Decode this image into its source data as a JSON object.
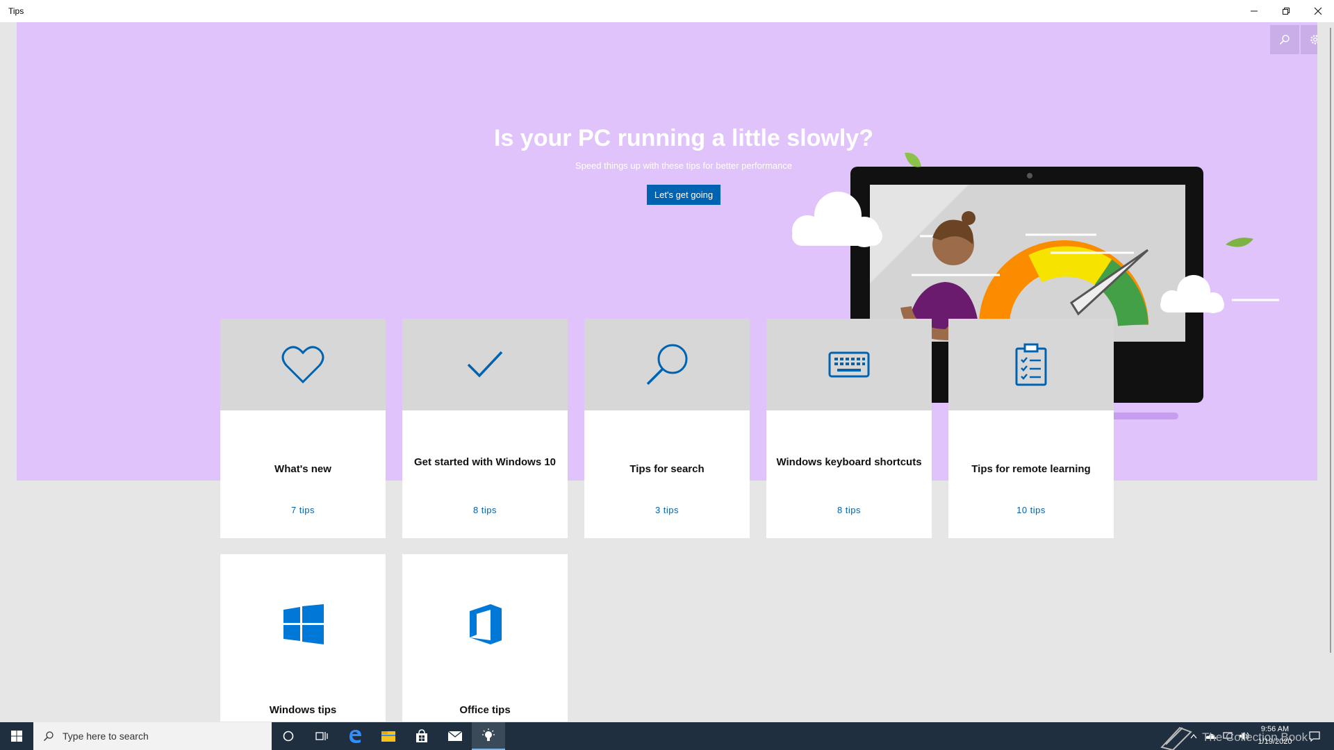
{
  "window": {
    "title": "Tips",
    "minimize_icon": "minimize-icon",
    "restore_icon": "restore-icon",
    "close_icon": "close-icon"
  },
  "hero": {
    "title": "Is your PC running a little slowly?",
    "subtitle": "Speed things up with these tips for better performance",
    "cta_label": "Let's get going",
    "background_color": "#e0c3fb"
  },
  "toolbar": {
    "search_icon": "search-icon",
    "settings_icon": "gear-icon"
  },
  "cards": [
    {
      "title": "What's new",
      "count": "7 tips",
      "icon": "heart-icon"
    },
    {
      "title": "Get started with Windows 10",
      "count": "8 tips",
      "icon": "checkmark-icon"
    },
    {
      "title": "Tips for search",
      "count": "3 tips",
      "icon": "magnifier-icon"
    },
    {
      "title": "Windows keyboard shortcuts",
      "count": "8 tips",
      "icon": "keyboard-icon"
    },
    {
      "title": "Tips for remote learning",
      "count": "10 tips",
      "icon": "clipboard-icon"
    },
    {
      "title": "Windows tips",
      "count": "",
      "icon": "windows-logo-icon"
    },
    {
      "title": "Office tips",
      "count": "",
      "icon": "office-logo-icon"
    }
  ],
  "taskbar": {
    "search_placeholder": "Type here to search",
    "clock_time": "9:56 AM",
    "clock_date": "1/19/2020",
    "watermark": "The Collection Book",
    "apps": [
      "start-icon",
      "cortana-icon",
      "task-view-icon",
      "edge-icon",
      "file-explorer-icon",
      "store-icon",
      "mail-icon",
      "tips-icon"
    ]
  },
  "colors": {
    "accent": "#0063b1",
    "taskbar": "#1f2f3f"
  }
}
